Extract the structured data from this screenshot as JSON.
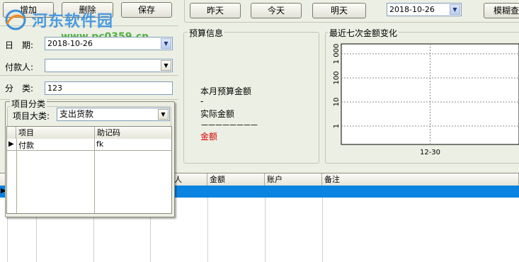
{
  "toolbar_left": {
    "add": "增加",
    "delete": "删除",
    "save": "保存"
  },
  "toolbar_right": {
    "yesterday": "昨天",
    "today": "今天",
    "tomorrow": "明天",
    "date_value": "2018-10-26",
    "fuzzy_search": "模糊查"
  },
  "watermark": {
    "name": "河东软件园",
    "url": "www.pc0359.cn"
  },
  "form": {
    "date_label": "日　期:",
    "date_value": "2018-10-26",
    "payer_label": "付款人:",
    "payer_value": "",
    "category_label": "分　类:",
    "category_value": "123"
  },
  "item_category": {
    "title": "项目分类",
    "big_category_label": "项目大类:",
    "big_category_value": "支出货款",
    "columns": [
      "项目",
      "助记码"
    ],
    "rows": [
      {
        "item": "付款",
        "code": "fk"
      }
    ]
  },
  "budget": {
    "title": "预算信息",
    "monthly_budget_label": "本月预算金额",
    "monthly_budget_value": "-",
    "actual_label": "实际金额",
    "dashes": "－－－－－－－－",
    "amount_label": "金额"
  },
  "chart_panel_title": "最近七次金额变化",
  "chart_data": {
    "type": "line",
    "title": "",
    "yscale": "log",
    "ytick_labels": [
      "1",
      "10",
      "100",
      "1 000"
    ],
    "ytick_values": [
      1,
      10,
      100,
      1000
    ],
    "x": [
      "12-30"
    ],
    "series": [],
    "grid": true
  },
  "main_table": {
    "columns": [
      "款人",
      "金额",
      "账户",
      "备注"
    ]
  },
  "colors": {
    "selected_row": "#0a84e0",
    "amount_red": "#d00000"
  }
}
